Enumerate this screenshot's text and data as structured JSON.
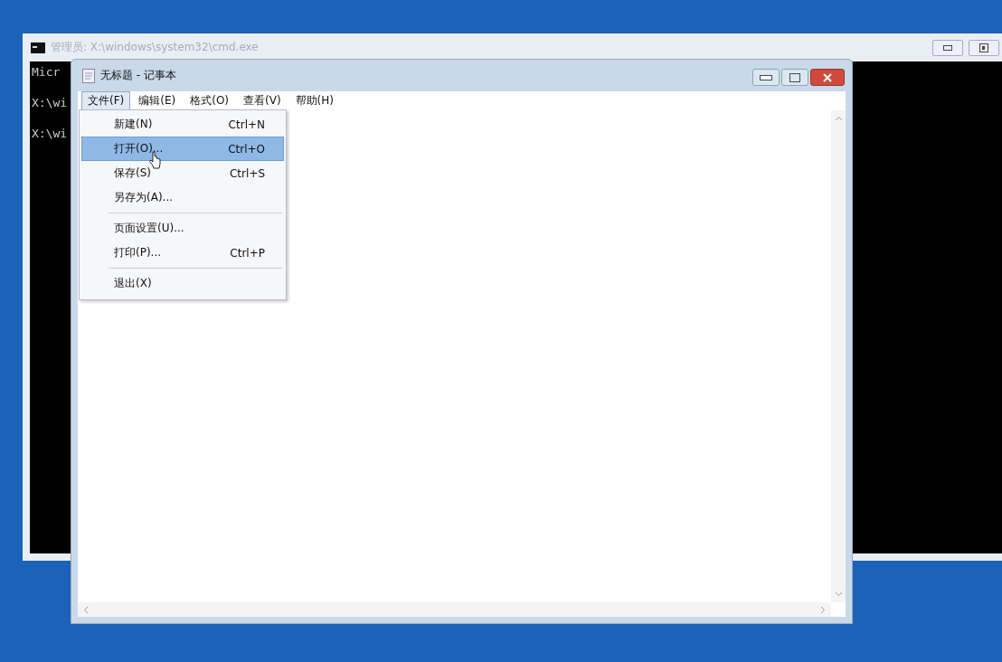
{
  "console_window": {
    "title": "管理员: X:\\windows\\system32\\cmd.exe",
    "lines": [
      "Micr",
      "X:\\wi",
      "X:\\wi"
    ]
  },
  "notepad": {
    "title": "无标题 - 记事本",
    "menus": [
      {
        "label": "文件(F)",
        "selected": true
      },
      {
        "label": "编辑(E)",
        "selected": false
      },
      {
        "label": "格式(O)",
        "selected": false
      },
      {
        "label": "查看(V)",
        "selected": false
      },
      {
        "label": "帮助(H)",
        "selected": false
      }
    ],
    "file_menu": [
      {
        "kind": "item",
        "label": "新建(N)",
        "shortcut": "Ctrl+N",
        "selected": false
      },
      {
        "kind": "item",
        "label": "打开(O)...",
        "shortcut": "Ctrl+O",
        "selected": true
      },
      {
        "kind": "item",
        "label": "保存(S)",
        "shortcut": "Ctrl+S",
        "selected": false
      },
      {
        "kind": "item",
        "label": "另存为(A)...",
        "selected": false
      },
      {
        "kind": "separator"
      },
      {
        "kind": "item",
        "label": "页面设置(U)...",
        "selected": false
      },
      {
        "kind": "item",
        "label": "打印(P)...",
        "shortcut": "Ctrl+P",
        "selected": false
      },
      {
        "kind": "separator"
      },
      {
        "kind": "item",
        "label": "退出(X)",
        "selected": false
      }
    ]
  }
}
